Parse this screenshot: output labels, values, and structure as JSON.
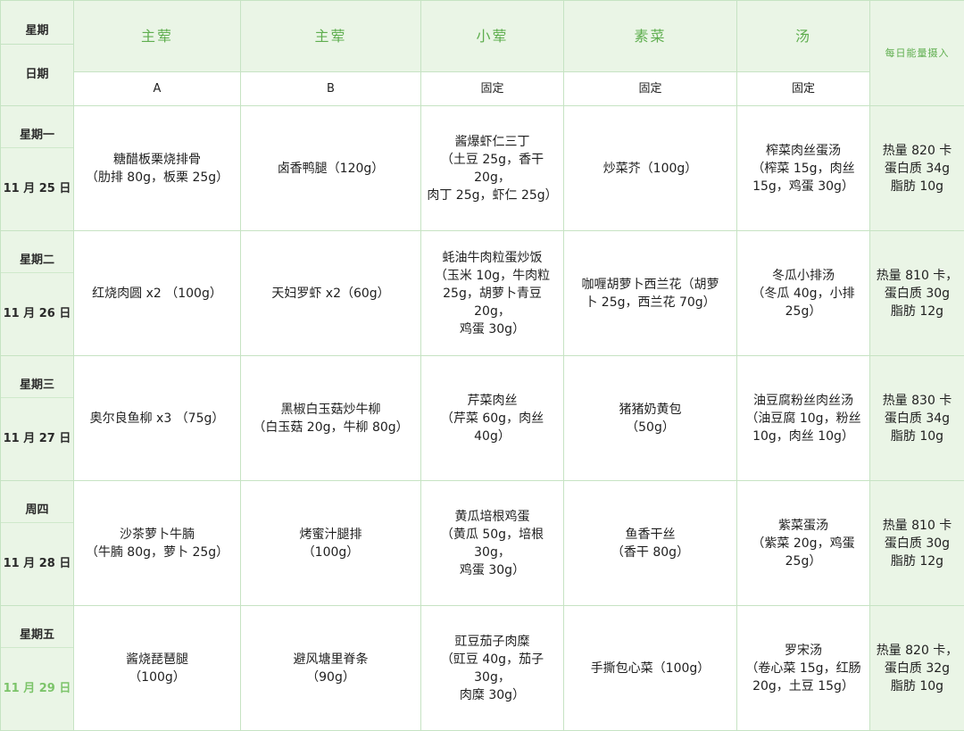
{
  "header": {
    "corner_top": "星期",
    "corner_bottom": "日期",
    "categories": [
      "主荤",
      "主荤",
      "小荤",
      "素菜",
      "汤",
      "每日能量摄入"
    ],
    "subtypes": [
      "A",
      "B",
      "固定",
      "固定",
      "固定",
      ""
    ]
  },
  "days": [
    {
      "weekday": "星期一",
      "date": "11 月 25 日",
      "dishes": [
        "糖醋板栗烧排骨\n（肋排 80g，板栗 25g）",
        "卤香鸭腿（120g）",
        "酱爆虾仁三丁\n（土豆 25g，香干 20g，\n肉丁 25g，虾仁 25g）",
        "炒菜芥（100g）",
        "榨菜肉丝蛋汤\n（榨菜 15g，肉丝\n15g，鸡蛋 30g）"
      ],
      "energy": "热量 820 卡\n蛋白质 34g\n脂肪 10g"
    },
    {
      "weekday": "星期二",
      "date": "11 月 26 日",
      "dishes": [
        "红烧肉圆 x2  （100g）",
        "天妇罗虾 x2（60g）",
        "蚝油牛肉粒蛋炒饭\n（玉米 10g，牛肉粒\n25g，胡萝卜青豆 20g，\n鸡蛋 30g）",
        "咖喱胡萝卜西兰花（胡萝\n卜 25g，西兰花 70g）",
        "冬瓜小排汤\n（冬瓜 40g，小排 25g）"
      ],
      "energy": "热量 810 卡，\n蛋白质 30g\n脂肪 12g"
    },
    {
      "weekday": "星期三",
      "date": "11 月 27 日",
      "dishes": [
        "奥尔良鱼柳 x3  （75g）",
        "黑椒白玉菇炒牛柳\n（白玉菇 20g，牛柳 80g）",
        "芹菜肉丝\n（芹菜 60g，肉丝 40g）",
        "猪猪奶黄包\n（50g）",
        "油豆腐粉丝肉丝汤\n（油豆腐 10g，粉丝\n10g，肉丝 10g）"
      ],
      "energy": "热量 830 卡\n蛋白质 34g\n脂肪 10g"
    },
    {
      "weekday": "周四",
      "date": "11 月 28 日",
      "dishes": [
        "沙茶萝卜牛腩\n（牛腩 80g，萝卜 25g）",
        "烤蜜汁腿排\n（100g）",
        "黄瓜培根鸡蛋\n（黄瓜 50g，培根 30g，\n鸡蛋 30g）",
        "鱼香干丝\n（香干 80g）",
        "紫菜蛋汤\n（紫菜 20g，鸡蛋\n25g）"
      ],
      "energy": "热量 810 卡\n蛋白质 30g\n脂肪 12g"
    },
    {
      "weekday": "星期五",
      "date": "11 月 29 日",
      "dishes": [
        "酱烧琵琶腿\n（100g）",
        "避风塘里脊条\n（90g）",
        "豇豆茄子肉糜\n（豇豆 40g，茄子 30g，\n肉糜 30g）",
        "手撕包心菜（100g）",
        "罗宋汤\n（卷心菜 15g，红肠\n20g，土豆 15g）"
      ],
      "energy": "热量 820 卡，\n蛋白质 32g\n脂肪 10g"
    }
  ],
  "colors": {
    "accent_green": "#5fae4f",
    "highlight_date": "#7cc46a",
    "header_bg": "#eaf5e6",
    "border": "#c6e3c3"
  }
}
